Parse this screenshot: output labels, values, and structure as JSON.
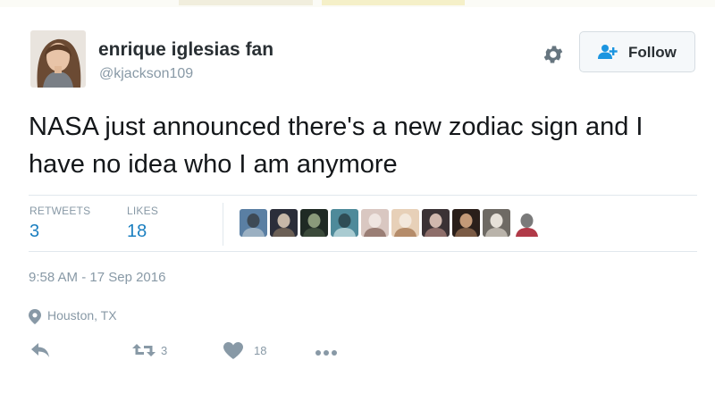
{
  "user": {
    "display_name": "enrique iglesias fan",
    "handle": "@kjackson109",
    "avatar_icon": "profile-photo"
  },
  "header": {
    "follow_label": "Follow",
    "gear_icon": "gear-icon",
    "follow_icon": "add-user-icon"
  },
  "tweet": {
    "text": "NASA just announced there's a new zodiac sign and I have no idea who I am anymore"
  },
  "stats": {
    "retweets_label": "RETWEETS",
    "retweets_value": "3",
    "likes_label": "LIKES",
    "likes_value": "18"
  },
  "likers": [
    {
      "name": "liker-avatar-1",
      "colors": [
        "#5a7fa3",
        "#9bb0c2",
        "#3e4a55"
      ]
    },
    {
      "name": "liker-avatar-2",
      "colors": [
        "#2b2e3a",
        "#6b5f55",
        "#c7b8a8"
      ]
    },
    {
      "name": "liker-avatar-3",
      "colors": [
        "#1f2a24",
        "#3b4a3a",
        "#8a9a7a"
      ]
    },
    {
      "name": "liker-avatar-4",
      "colors": [
        "#4e8a9a",
        "#a9cbd1",
        "#2f4d55"
      ]
    },
    {
      "name": "liker-avatar-5",
      "colors": [
        "#d9c7c1",
        "#9a7e75",
        "#efe5e1"
      ]
    },
    {
      "name": "liker-avatar-6",
      "colors": [
        "#e7d0b8",
        "#b58c6a",
        "#f3e8dc"
      ]
    },
    {
      "name": "liker-avatar-7",
      "colors": [
        "#3b3235",
        "#8e6e6a",
        "#d1b8ae"
      ]
    },
    {
      "name": "liker-avatar-8",
      "colors": [
        "#2a1f1a",
        "#7a5a44",
        "#c49a78"
      ]
    },
    {
      "name": "liker-avatar-9",
      "colors": [
        "#6e6a64",
        "#b9b3aa",
        "#e6e1d9"
      ]
    },
    {
      "name": "liker-avatar-10",
      "colors": [
        "#ffffff",
        "#b03a48",
        "#7a7a7a"
      ]
    }
  ],
  "meta": {
    "timestamp": "9:58 AM - 17 Sep 2016",
    "location": "Houston, TX",
    "location_icon": "location-pin-icon"
  },
  "actions": {
    "reply_icon": "reply-icon",
    "retweet_icon": "retweet-icon",
    "retweet_count": "3",
    "like_icon": "heart-icon",
    "like_count": "18",
    "more_icon": "more-icon"
  },
  "colors": {
    "accent": "#1b7fc0",
    "muted": "#8899a6",
    "text": "#14171a",
    "divider": "#e1e8ed"
  }
}
